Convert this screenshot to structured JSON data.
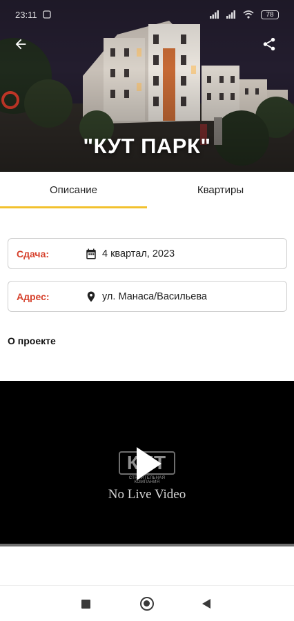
{
  "status_bar": {
    "time": "23:11",
    "battery": "78"
  },
  "header": {
    "title": "\"КУТ ПАРК\""
  },
  "tabs": [
    {
      "label": "Описание",
      "active": true
    },
    {
      "label": "Квартиры",
      "active": false
    }
  ],
  "info": {
    "delivery": {
      "label": "Сдача:",
      "value": "4 квартал, 2023",
      "icon": "calendar-icon"
    },
    "address": {
      "label": "Адрес:",
      "value": "ул. Манаса/Васильева",
      "icon": "location-pin-icon"
    }
  },
  "about": {
    "title": "О проекте"
  },
  "video": {
    "logo_text": "КУТ",
    "logo_subtitle": "СТРОИТЕЛЬНАЯ КОМПАНИЯ",
    "message": "No Live Video"
  },
  "colors": {
    "accent": "#f2c12e",
    "label_red": "#d6402b"
  }
}
